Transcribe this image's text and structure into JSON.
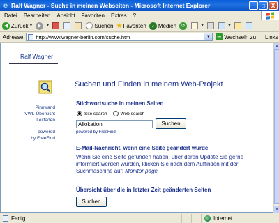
{
  "window": {
    "title": "Ralf Wagner - Suche in meinen Webseiten - Microsoft Internet Explorer",
    "minimize": "_",
    "maximize": "□",
    "close": "X"
  },
  "menu": [
    "Datei",
    "Bearbeiten",
    "Ansicht",
    "Favoriten",
    "Extras",
    "?"
  ],
  "toolbar": {
    "back": "Zurück",
    "search": "Suchen",
    "favorites": "Favoriten",
    "media": "Medien"
  },
  "address": {
    "label": "Adresse",
    "url": "http://www.wagner-berlin.com/suche.htm",
    "go": "Wechseln zu",
    "links": "Links"
  },
  "sidebar": {
    "author": "Ralf Wagner",
    "nav": [
      "Pinnwand",
      "VWL-Übersicht",
      "Leitfaden"
    ],
    "powered": [
      "powered",
      "by FreeFind"
    ]
  },
  "main": {
    "title": "Suchen und Finden in meinem Web-Projekt",
    "keyword_heading": "Stichwortsuche in meinen Seiten",
    "radio_site": "Site search",
    "radio_web": "Web search",
    "search_value": "Allokation",
    "search_button": "Suchen",
    "powered_by": "powered by FreeFind",
    "email_heading": "E-Mail-Nachricht, wenn eine Seite geändert wurde",
    "email_text": "Wenn Sie eine Seite gefunden haben, über deren Update Sie gerne informiert werden würden, klicken Sie nach dem Auffinden mit der Suchmaschine auf:",
    "email_link": "Monitor page",
    "changes_heading": "Übersicht über die in letzter Zeit geänderten Seiten",
    "changes_button": "Suchen"
  },
  "status": {
    "text": "Fertig",
    "zone": "Internet"
  }
}
